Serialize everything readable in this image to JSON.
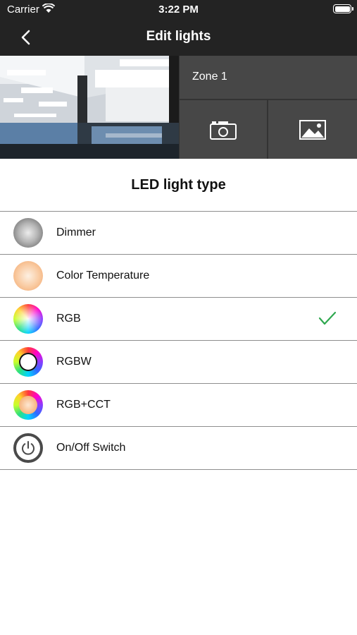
{
  "status": {
    "carrier": "Carrier",
    "time": "3:22 PM"
  },
  "nav": {
    "title": "Edit lights",
    "back_icon": "chevron-left-icon"
  },
  "zone": {
    "name": "Zone 1",
    "camera_icon": "camera-icon",
    "gallery_icon": "image-gallery-icon"
  },
  "section": {
    "heading": "LED light type"
  },
  "light_types": [
    {
      "label": "Dimmer",
      "icon": "dimmer-icon",
      "selected": false
    },
    {
      "label": "Color Temperature",
      "icon": "color-temperature-icon",
      "selected": false
    },
    {
      "label": "RGB",
      "icon": "rgb-icon",
      "selected": true
    },
    {
      "label": "RGBW",
      "icon": "rgbw-icon",
      "selected": false
    },
    {
      "label": "RGB+CCT",
      "icon": "rgb-cct-icon",
      "selected": false
    },
    {
      "label": "On/Off Switch",
      "icon": "power-icon",
      "selected": false
    }
  ],
  "colors": {
    "bar": "#232323",
    "tile": "#474747",
    "check": "#2fa84f",
    "divider": "#8e8e8e"
  }
}
